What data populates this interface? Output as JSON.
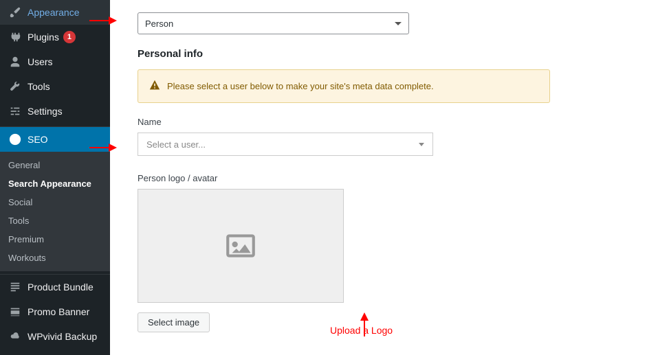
{
  "sidebar": {
    "items": [
      {
        "label": "Appearance",
        "icon": "brush-icon"
      },
      {
        "label": "Plugins",
        "icon": "plug-icon",
        "badge": "1"
      },
      {
        "label": "Users",
        "icon": "user-icon"
      },
      {
        "label": "Tools",
        "icon": "wrench-icon"
      },
      {
        "label": "Settings",
        "icon": "sliders-icon"
      },
      {
        "label": "SEO",
        "icon": "yoast-icon",
        "active": true
      },
      {
        "label": "Product Bundle",
        "icon": "post-icon"
      },
      {
        "label": "Promo Banner",
        "icon": "banner-icon"
      },
      {
        "label": "WPvivid Backup",
        "icon": "cloud-icon"
      }
    ],
    "submenu": [
      {
        "label": "General"
      },
      {
        "label": "Search Appearance",
        "current": true
      },
      {
        "label": "Social"
      },
      {
        "label": "Tools"
      },
      {
        "label": "Premium"
      },
      {
        "label": "Workouts"
      }
    ]
  },
  "content": {
    "type_dropdown": {
      "selected": "Person"
    },
    "section_heading": "Personal info",
    "warning": "Please select a user below to make your site's meta data complete.",
    "name_label": "Name",
    "user_select": {
      "placeholder": "Select a user..."
    },
    "avatar_label": "Person logo / avatar",
    "select_image_btn": "Select image",
    "annotation_upload": "Upload a Logo"
  },
  "colors": {
    "accent": "#0073aa",
    "badge": "#d63638",
    "warning_bg": "#fdf4e0",
    "warning_text": "#815b00",
    "annotation": "#ff0000"
  }
}
